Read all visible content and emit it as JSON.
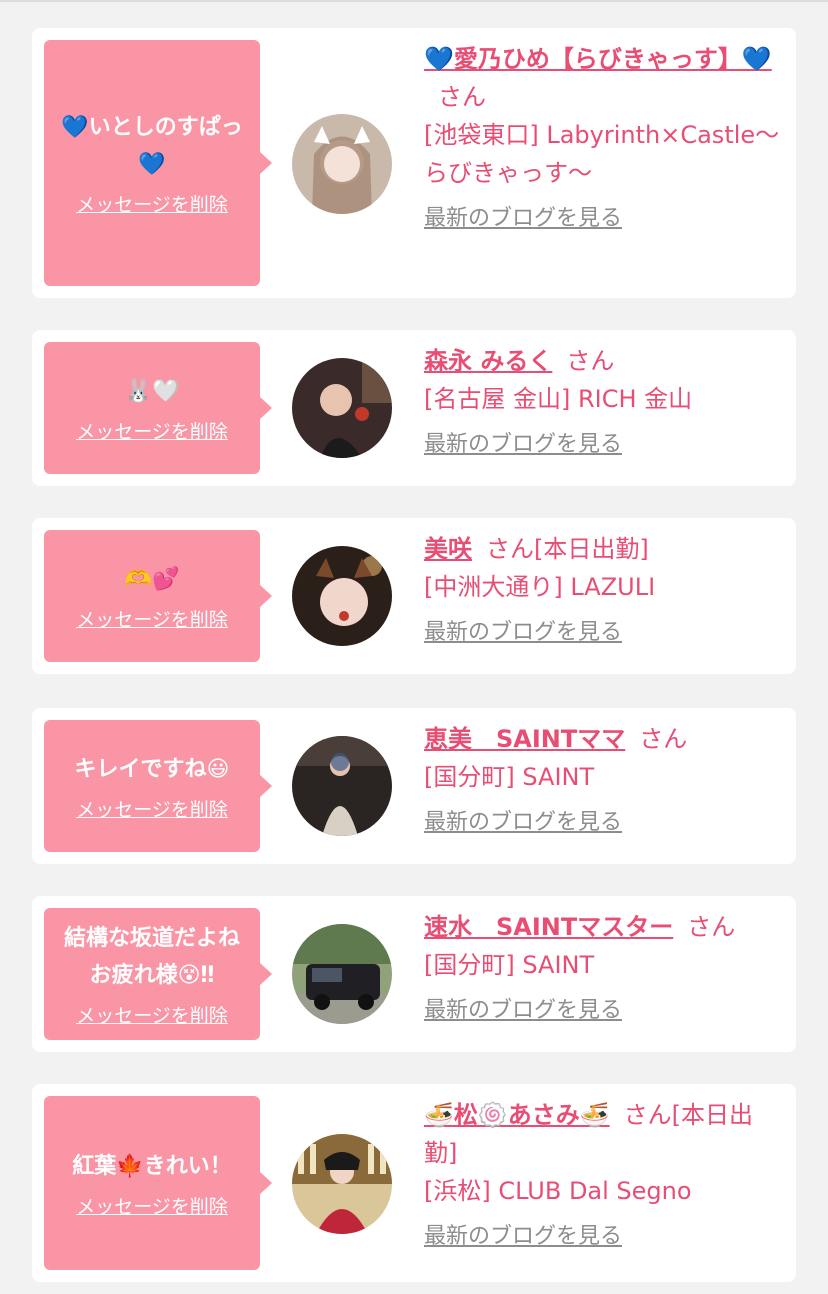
{
  "items": [
    {
      "message": "💙いとしのすぱっ\n💙",
      "delete_label": "メッセージを削除",
      "name": "💙愛乃ひめ【らびきゃっす】💙",
      "honorific": "さん",
      "status": "",
      "shop": "[池袋東口] Labyrinth×Castle〜らびきゃっす〜",
      "blog_label": "最新のブログを見る"
    },
    {
      "message": "🐰🤍",
      "delete_label": "メッセージを削除",
      "name": "森永 みるく",
      "honorific": "さん",
      "status": "",
      "shop": "[名古屋 金山] RICH 金山",
      "blog_label": "最新のブログを見る"
    },
    {
      "message": "🫶💕",
      "delete_label": "メッセージを削除",
      "name": "美咲",
      "honorific": "さん",
      "status": "[本日出勤]",
      "shop": "[中洲大通り] LAZULI",
      "blog_label": "最新のブログを見る"
    },
    {
      "message": "キレイですね😃",
      "delete_label": "メッセージを削除",
      "name": "恵美　SAINTママ",
      "honorific": "さん",
      "status": "",
      "shop": "[国分町] SAINT",
      "blog_label": "最新のブログを見る"
    },
    {
      "message": "結構な坂道だよね\nお疲れ様😵‼",
      "delete_label": "メッセージを削除",
      "name": "速水　SAINTマスター",
      "honorific": "さん",
      "status": "",
      "shop": "[国分町] SAINT",
      "blog_label": "最新のブログを見る"
    },
    {
      "message": "紅葉🍁きれい！",
      "delete_label": "メッセージを削除",
      "name": "🍜松🍥あさみ🍜",
      "honorific": "さん",
      "status": "[本日出勤]",
      "shop": "[浜松] CLUB Dal Segno",
      "blog_label": "最新のブログを見る"
    }
  ],
  "colors": {
    "accent": "#e84e74",
    "bubble": "#fa95a6",
    "background": "#f2f2f2",
    "muted": "#8d8d8d"
  }
}
